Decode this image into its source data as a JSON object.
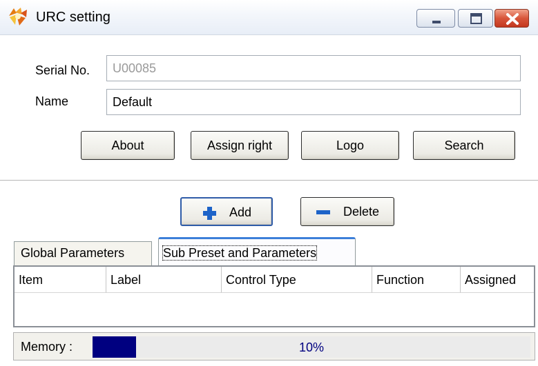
{
  "window": {
    "title": "URC setting",
    "controls": [
      "minimize",
      "maximize",
      "close"
    ]
  },
  "form": {
    "serial_label": "Serial No.",
    "serial_value": "U00085",
    "name_label": "Name",
    "name_value": "Default"
  },
  "actions": {
    "about_label": "About",
    "assign_right_label": "Assign right",
    "logo_label": "Logo",
    "search_label": "Search"
  },
  "list_actions": {
    "add_label": "Add",
    "delete_label": "Delete"
  },
  "tabs": [
    {
      "label": "Global Parameters",
      "active": false
    },
    {
      "label": "Sub Preset and Parameters",
      "active": true
    }
  ],
  "table": {
    "columns": [
      "Item",
      "Label",
      "Control Type",
      "Function",
      "Assigned"
    ],
    "rows": []
  },
  "status": {
    "memory_label": "Memory :",
    "memory_percent": 10,
    "memory_text": "10%"
  },
  "colors": {
    "progress_fill": "#000080",
    "active_tab_accent": "#3c7fd9",
    "close_button": "#c3381f",
    "add_icon": "#1d63c8",
    "delete_icon": "#1d63c8"
  }
}
